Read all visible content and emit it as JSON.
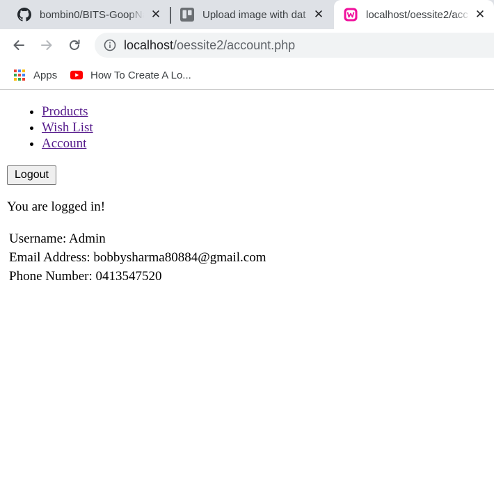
{
  "browser": {
    "tabs": [
      {
        "title": "bombin0/BITS-GoopNa",
        "favicon": "github-icon",
        "active": false
      },
      {
        "title": "Upload image with dat",
        "favicon": "trello-icon",
        "active": false
      },
      {
        "title": "localhost/oessite2/acc",
        "favicon": "wampserver-icon",
        "active": true
      }
    ],
    "address_bar": {
      "host": "localhost",
      "path": "/oessite2/account.php"
    },
    "bookmarks": [
      {
        "label": "Apps",
        "icon": "apps-grid-icon"
      },
      {
        "label": "How To Create A Lo...",
        "icon": "youtube-icon"
      }
    ]
  },
  "page": {
    "nav": {
      "items": [
        {
          "label": "Products"
        },
        {
          "label": "Wish List"
        },
        {
          "label": "Account"
        }
      ]
    },
    "logout_label": "Logout",
    "status_text": "You are logged in!",
    "account": {
      "username": "Username: Admin",
      "email": "Email Address: bobbysharma80884@gmail.com",
      "phone": "Phone Number: 0413547520"
    }
  },
  "colors": {
    "tabstrip": "#dee1e6",
    "omnibox": "#f1f3f4",
    "visited_link": "#551a8b",
    "youtube_red": "#ff0000",
    "wamp_pink": "#f0119c"
  }
}
